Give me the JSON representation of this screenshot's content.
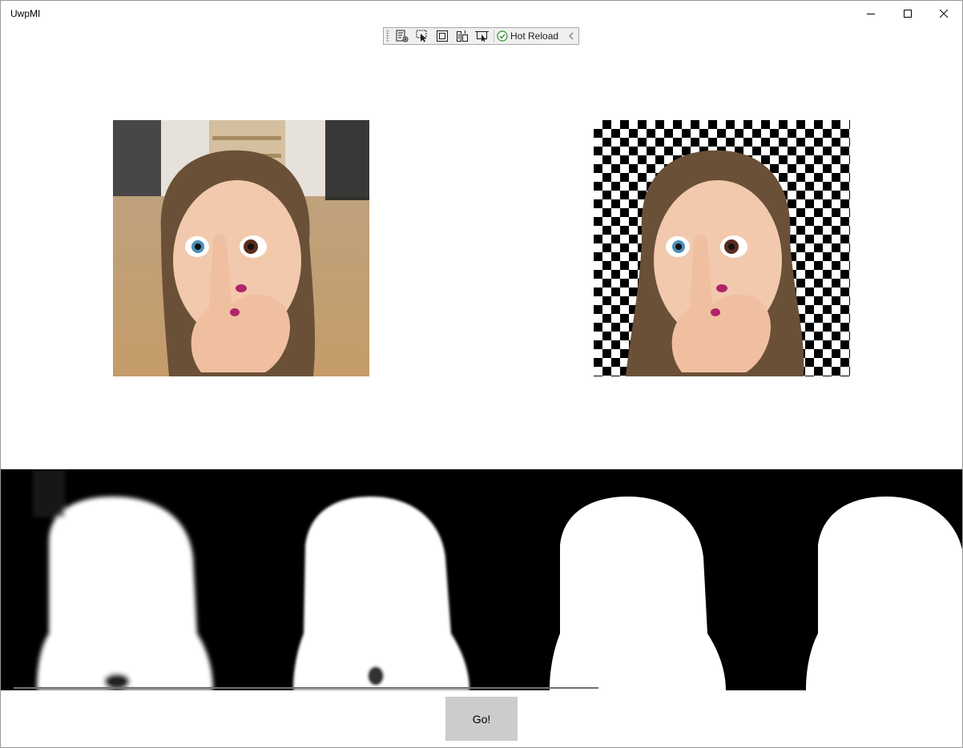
{
  "window": {
    "title": "UwpMI"
  },
  "window_controls": {
    "minimize_icon": "minimize-icon",
    "maximize_icon": "maximize-icon",
    "close_icon": "close-icon"
  },
  "hot_reload_toolbar": {
    "tools": [
      {
        "icon": "visual-tree-icon"
      },
      {
        "icon": "select-element-icon"
      },
      {
        "icon": "display-adorners-icon"
      },
      {
        "icon": "track-focus-icon"
      },
      {
        "icon": "layout-adorners-icon"
      }
    ],
    "status_icon": "check-circle-icon",
    "label": "Hot Reload",
    "collapse_icon": "chevron-left-icon"
  },
  "images": {
    "original": {
      "description_icon": "photo-original"
    },
    "matted": {
      "description_icon": "photo-background-removed"
    }
  },
  "colors": {
    "hot_reload_check": "#2e8b2e",
    "matte_background": "#000000",
    "matte_foreground": "#ffffff",
    "button_background": "#cccccc"
  },
  "matte_masks": {
    "count": 4
  },
  "progress": {
    "value_fraction": 0.61
  },
  "go_button": {
    "label": "Go!"
  }
}
